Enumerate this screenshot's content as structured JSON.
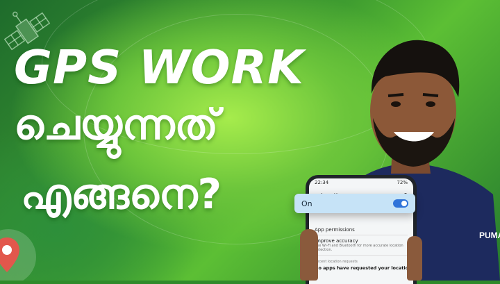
{
  "headline": {
    "line1": "GPS WORK",
    "line2": "ചെയ്യുന്നത്",
    "line3": "എങ്ങനെ?"
  },
  "phone": {
    "status_time": "22:34",
    "status_battery": "72%",
    "title": "Location",
    "toggle_label": "On",
    "toggle_on": true,
    "app_permissions": "App permissions",
    "improve_accuracy_title": "Improve accuracy",
    "improve_accuracy_desc": "Use Wi-Fi and Bluetooth for more accurate location detection.",
    "recent_label": "Recent location requests",
    "no_apps_text": "No apps have requested your location re..."
  },
  "shirt_brand": "PUMA",
  "colors": {
    "accent_green": "#6cc53b",
    "toggle_blue": "#2f73d9",
    "toggle_bar": "#c6e3f7",
    "shirt_navy": "#1d2a5e"
  },
  "icons": [
    "satellite-icon",
    "location-pin-icon",
    "back-arrow-icon",
    "search-icon"
  ]
}
